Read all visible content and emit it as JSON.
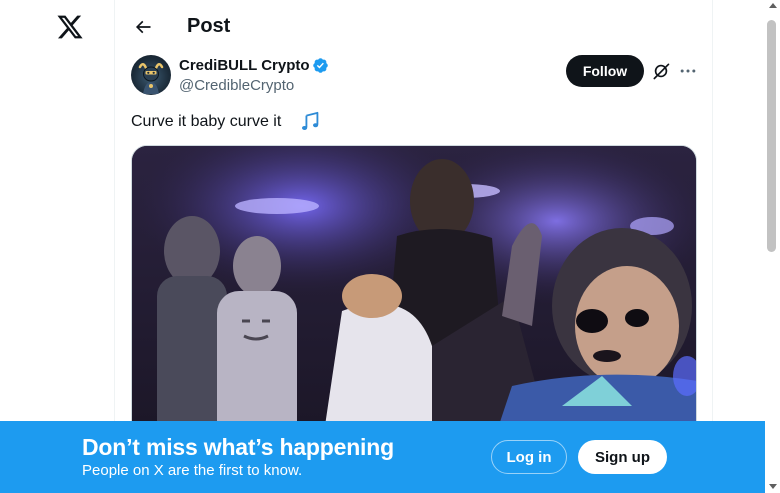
{
  "header": {
    "title": "Post"
  },
  "tweet": {
    "author_name": "CrediBULL Crypto",
    "author_handle": "@CredibleCrypto",
    "text": "Curve it baby curve it",
    "follow_label": "Follow"
  },
  "bottom_bar": {
    "title": "Don’t miss what’s happening",
    "subtitle": "People on X are the first to know.",
    "login_label": "Log in",
    "signup_label": "Sign up"
  },
  "icons": {
    "logo": "x-logo-icon",
    "back": "arrow-left-icon",
    "verified": "verified-badge-icon",
    "grok": "grok-icon",
    "more": "more-horizontal-icon",
    "emoji": "musical-notes-icon"
  },
  "colors": {
    "accent": "#1d9bf0",
    "text_primary": "#0f1419",
    "text_secondary": "#536471",
    "follow_bg": "#0f1419"
  }
}
